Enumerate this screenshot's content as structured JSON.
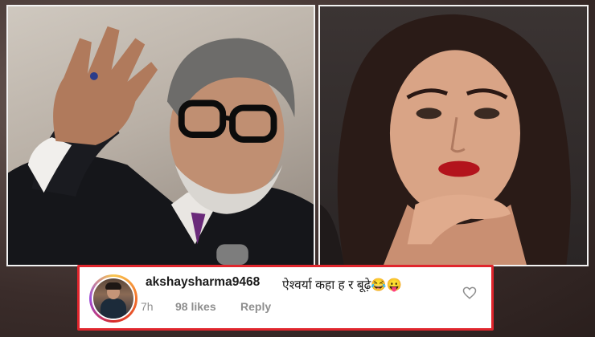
{
  "left_photo": {
    "subject": "man-gesturing-photo"
  },
  "right_photo": {
    "subject": "woman-portrait-photo"
  },
  "comment": {
    "username": "akshaysharma9468",
    "text": "ऐश्वर्या कहा ह र बूढ़े😂😛",
    "time": "7h",
    "likes": "98 likes",
    "reply_label": "Reply",
    "like_icon": "heart-icon",
    "border_color": "#e0262d"
  }
}
